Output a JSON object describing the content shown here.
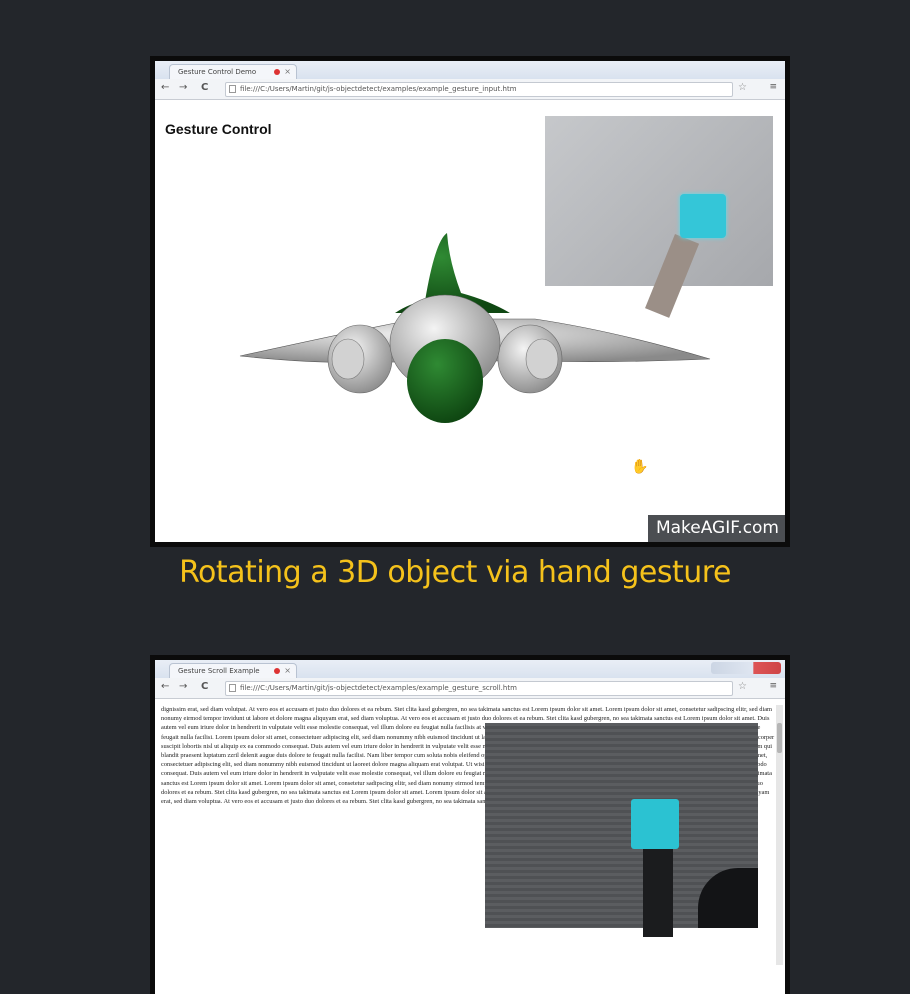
{
  "caption1": "Rotating a 3D object via hand gesture",
  "demo1": {
    "tab_title": "Gesture Control Demo",
    "address": "file:///C:/Users/Martin/git/js-objectdetect/examples/example_gesture_input.htm",
    "heading": "Gesture Control",
    "watermark": "MakeAGIF.com"
  },
  "demo2": {
    "tab_title": "Gesture Scroll Example",
    "address": "file:///C:/Users/Martin/git/js-objectdetect/examples/example_gesture_scroll.htm",
    "body_text": "dignissim erat, sed diam volutpat. At vero eos et accusam et justo duo dolores et ea rebum. Stet clita kasd gubergren, no sea takimata sanctus est Lorem ipsum dolor sit amet. Lorem ipsum dolor sit amet, consetetur sadipscing elitr, sed diam nonumy eirmod tempor invidunt ut labore et dolore magna aliquyam erat, sed diam voluptua. At vero eos et accusam et justo duo dolores et ea rebum. Stet clita kasd gubergren, no sea takimata sanctus est Lorem ipsum dolor sit amet. Duis autem vel eum iriure dolor in hendrerit in vulputate velit esse molestie consequat, vel illum dolore eu feugiat nulla facilisis at vero eros et accumsan et iusto odio dignissim qui blandit praesent luptatum zzril delenit augue duis dolore te feugait nulla facilisi. Lorem ipsum dolor sit amet, consectetuer adipiscing elit, sed diam nonummy nibh euismod tincidunt ut laoreet dolore magna aliquam erat volutpat. Ut wisi enim ad minim veniam, quis nostrud exerci tation ullamcorper suscipit lobortis nisl ut aliquip ex ea commodo consequat. Duis autem vel eum iriure dolor in hendrerit in vulputate velit esse molestie consequat, vel illum dolore eu feugiat nulla facilisis at vero eros et accumsan et iusto odio dignissim qui blandit praesent luptatum zzril delenit augue duis dolore te feugait nulla facilisi. Nam liber tempor cum soluta nobis eleifend option congue nihil imperdiet doming id quod mazim placerat facer possim assum. Lorem ipsum dolor sit amet, consectetuer adipiscing elit, sed diam nonummy nibh euismod tincidunt ut laoreet dolore magna aliquam erat volutpat. Ut wisi enim ad minim veniam, quis nostrud exerci tation ullamcorper suscipit lobortis nisl ut aliquip ex ea commodo consequat. Duis autem vel eum iriure dolor in hendrerit in vulputate velit esse molestie consequat, vel illum dolore eu feugiat nulla facilisis. At vero eos et accusam et justo duo dolores et ea rebum. Stet clita kasd gubergren, no sea takimata sanctus est Lorem ipsum dolor sit amet. Lorem ipsum dolor sit amet, consetetur sadipscing elitr, sed diam nonumy eirmod tempor invidunt ut labore et dolore magna aliquyam erat, sed diam voluptua. At vero eos et accusam et justo duo dolores et ea rebum. Stet clita kasd gubergren, no sea takimata sanctus est Lorem ipsum dolor sit amet. Lorem ipsum dolor sit amet, consetetur sadipscing elitr, sed diam nonumy eirmod tempor invidunt ut labore et dolore magna aliquyam erat, sed diam voluptua. At vero eos et accusam et justo duo dolores et ea rebum. Stet clita kasd gubergren, no sea takimata sanctus est Lorem ipsum dolor sit amet."
  },
  "icons": {
    "back": "←",
    "forward": "→",
    "reload": "C",
    "star": "☆",
    "menu": "≡",
    "close": "×",
    "cursor": "✋"
  },
  "colors": {
    "caption": "#f5c21b",
    "marker": "#34c6d8",
    "plane_green": "#1f6b24",
    "background": "#23262b"
  }
}
